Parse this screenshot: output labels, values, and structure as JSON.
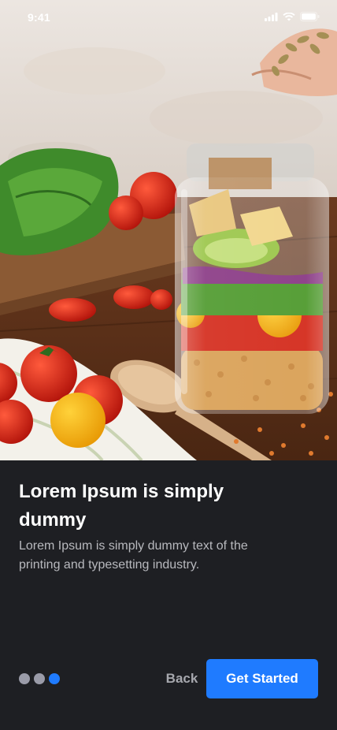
{
  "status_bar": {
    "time": "9:41",
    "icons": [
      "signal-icon",
      "wifi-icon",
      "battery-icon"
    ]
  },
  "hero": {
    "image": "food-jar-salad-photo"
  },
  "onboarding": {
    "title": "Lorem Ipsum is simply dummy",
    "description": "Lorem Ipsum is simply dummy text of the printing and typesetting industry.",
    "page_indicator": {
      "total": 3,
      "active_index": 2
    },
    "back_label": "Back",
    "cta_label": "Get Started"
  },
  "colors": {
    "background": "#1e1f23",
    "accent": "#1f7bff",
    "dot_inactive": "#9a9ba8",
    "text_primary": "#ffffff",
    "text_secondary": "#b8b9be"
  }
}
